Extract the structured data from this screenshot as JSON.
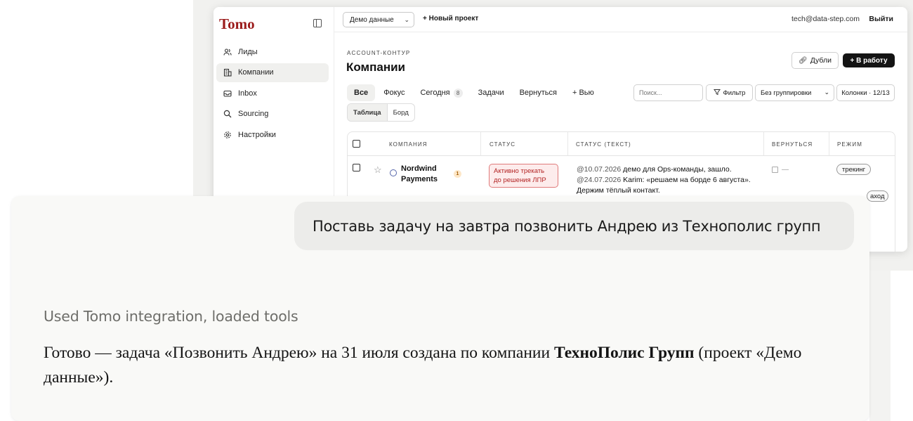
{
  "app": {
    "logo": "Tomo",
    "sidebar": {
      "items": [
        {
          "label": "Лиды",
          "icon": "users-icon"
        },
        {
          "label": "Компании",
          "icon": "building-icon",
          "active": true
        },
        {
          "label": "Inbox",
          "icon": "inbox-icon"
        },
        {
          "label": "Sourcing",
          "icon": "search-icon"
        },
        {
          "label": "Настройки",
          "icon": "gear-icon"
        }
      ]
    },
    "topbar": {
      "project_select": "Демо данные",
      "new_project": "+ Новый проект",
      "user_email": "tech@data-step.com",
      "logout": "Выйти"
    },
    "page": {
      "eyebrow": "ACCOUNT-КОНТУР",
      "title": "Компании",
      "dup_button": "Дубли",
      "work_button": "+ В работу"
    },
    "tabs": [
      {
        "label": "Все",
        "active": true
      },
      {
        "label": "Фокус"
      },
      {
        "label": "Сегодня",
        "count": "8"
      },
      {
        "label": "Задачи"
      },
      {
        "label": "Вернуться"
      },
      {
        "label": "+ Вью"
      }
    ],
    "toolbar": {
      "search_placeholder": "Поиск...",
      "filter": "Фильтр",
      "grouping": "Без группировки",
      "columns": "Колонки · 12/13"
    },
    "views": {
      "table": "Таблица",
      "board": "Борд"
    },
    "table": {
      "headers": [
        "КОМПАНИЯ",
        "СТАТУС",
        "СТАТУС (ТЕКСТ)",
        "ВЕРНУТЬСЯ",
        "РЕЖИМ"
      ],
      "rows": [
        {
          "company": "Nordwind Payments",
          "badge": "1",
          "status": "Активно трекать до решения ЛПР",
          "status_text_date1": "@10.07.2026",
          "status_text_1": "демо для Ops-команды, зашло.",
          "status_text_date2": "@24.07.2026",
          "status_text_2": "Karim: «решаем на борде 6 августа». Держим тёплый контакт.",
          "return": "—",
          "mode": "трекинг"
        }
      ],
      "partial_mode": "аход"
    }
  },
  "chat": {
    "user_message": "Поставь задачу на завтра позвонить Андрею из Технополис групп",
    "tools_note": "Used Tomo integration, loaded tools",
    "answer_part1": "Готово — задача «Позвонить Андрею» на 31 июля создана по компании ",
    "answer_bold": "ТехноПолис Групп",
    "answer_part2": " (проект «Демо данные»)."
  },
  "colors": {
    "logo": "#9b1c1c",
    "status_pill_bg": "#fdecec",
    "status_pill_border": "#e07a7a",
    "work_button": "#141414"
  }
}
